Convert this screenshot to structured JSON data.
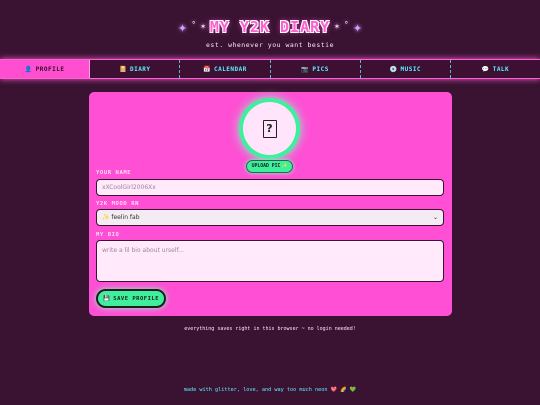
{
  "header": {
    "title": "MY Y2K DIARY",
    "subtitle": "est. whenever you want bestie",
    "sparkle_large": "✦",
    "sparkle_small": "˚",
    "star": "✶"
  },
  "nav": {
    "tabs": [
      {
        "label": "PROFILE",
        "icon": "👤",
        "active": true
      },
      {
        "label": "DIARY",
        "icon": "📔",
        "active": false
      },
      {
        "label": "CALENDAR",
        "icon": "📅",
        "active": false
      },
      {
        "label": "PICS",
        "icon": "📷",
        "active": false
      },
      {
        "label": "MUSIC",
        "icon": "💿",
        "active": false
      },
      {
        "label": "TALK",
        "icon": "💬",
        "active": false
      }
    ]
  },
  "profile": {
    "avatar_placeholder": "?",
    "upload_label": "UPLOAD PIC",
    "upload_icon": "✨",
    "name_label": "YOUR NAME",
    "name_placeholder": "xXCoolGirl2006Xx",
    "mood_label": "Y2K MOOD RN",
    "mood_selected": "✨ feelin fab",
    "bio_label": "MY BIO",
    "bio_placeholder": "write a lil bio about urself...",
    "save_label": "SAVE PROFILE",
    "save_icon": "💾"
  },
  "note": "everything saves right in this browser ~ no login needed!",
  "footer": {
    "text": "made with glitter, love, and way too much neon",
    "emojis": "💖 🌈 💚"
  },
  "colors": {
    "background": "#3a1232",
    "pink": "#ff4fd4",
    "mint": "#3ef09c",
    "cyan": "#5ff0ff"
  }
}
